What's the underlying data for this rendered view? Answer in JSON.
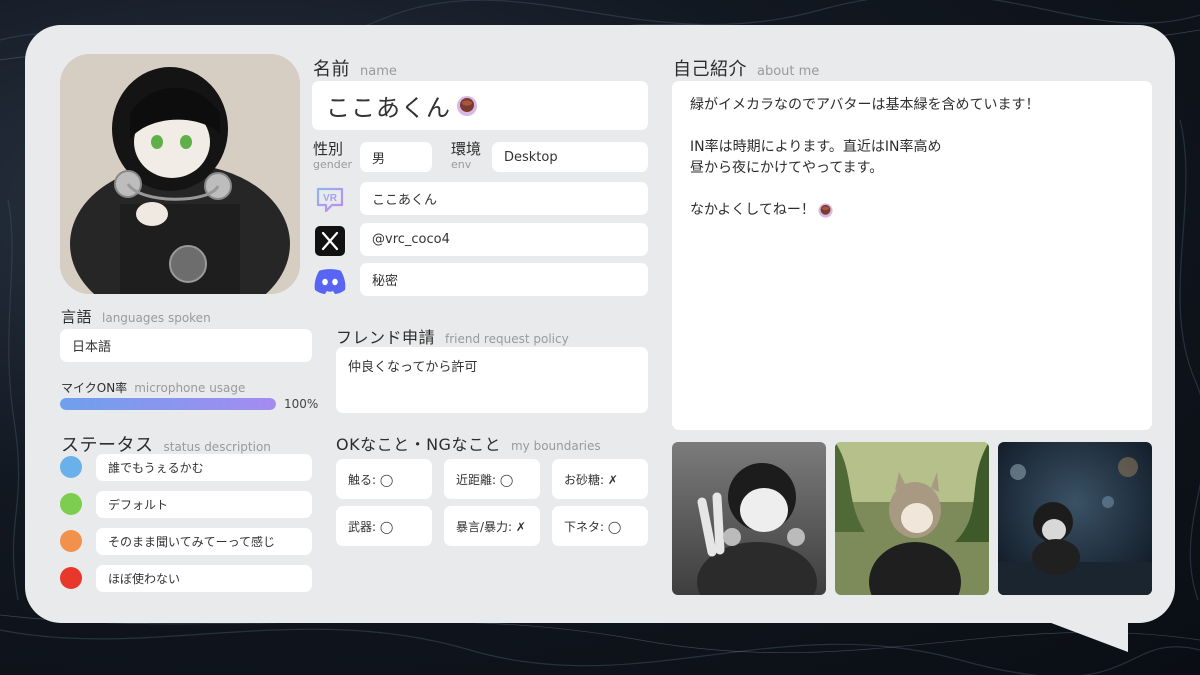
{
  "name_section": {
    "title_ja": "名前",
    "title_en": "name",
    "value": "ここあくん"
  },
  "gender": {
    "title_ja": "性別",
    "title_en": "gender",
    "value": "男"
  },
  "env": {
    "title_ja": "環境",
    "title_en": "env",
    "value": "Desktop"
  },
  "accounts": {
    "vrchat": "ここあくん",
    "x": "@vrc_coco4",
    "discord": "秘密"
  },
  "languages": {
    "title_ja": "言語",
    "title_en": "languages spoken",
    "value": "日本語"
  },
  "mic": {
    "title_ja": "マイクON率",
    "title_en": "microphone usage",
    "percent_text": "100%",
    "percent": 100
  },
  "status": {
    "title_ja": "ステータス",
    "title_en": "status description",
    "items": [
      {
        "label": "誰でもうぇるかむ",
        "color": "#6ab0ea"
      },
      {
        "label": "デフォルト",
        "color": "#7dce4e"
      },
      {
        "label": "そのまま聞いてみてーって感じ",
        "color": "#f2914c"
      },
      {
        "label": "ほぼ使わない",
        "color": "#e8382c"
      }
    ]
  },
  "friend": {
    "title_ja": "フレンド申請",
    "title_en": "friend request policy",
    "value": "仲良くなってから許可"
  },
  "boundaries": {
    "title_ja": "OKなこと・NGなこと",
    "title_en": "my boundaries",
    "items": [
      "触る: ◯",
      "近距離: ◯",
      "お砂糖: ✗",
      "武器: ◯",
      "暴言/暴力: ✗",
      "下ネタ: ◯"
    ]
  },
  "about": {
    "title_ja": "自己紹介",
    "title_en": "about me",
    "line1": "緑がイメカラなのでアバターは基本緑を含めています！",
    "line2": "IN率は時期によります。直近はIN率高め",
    "line3": "昼から夜にかけてやってます。",
    "line4": "なかよくしてねー！"
  },
  "icons": [
    "vrchat-icon",
    "x-icon",
    "discord-icon",
    "coffee-cup-icon"
  ]
}
